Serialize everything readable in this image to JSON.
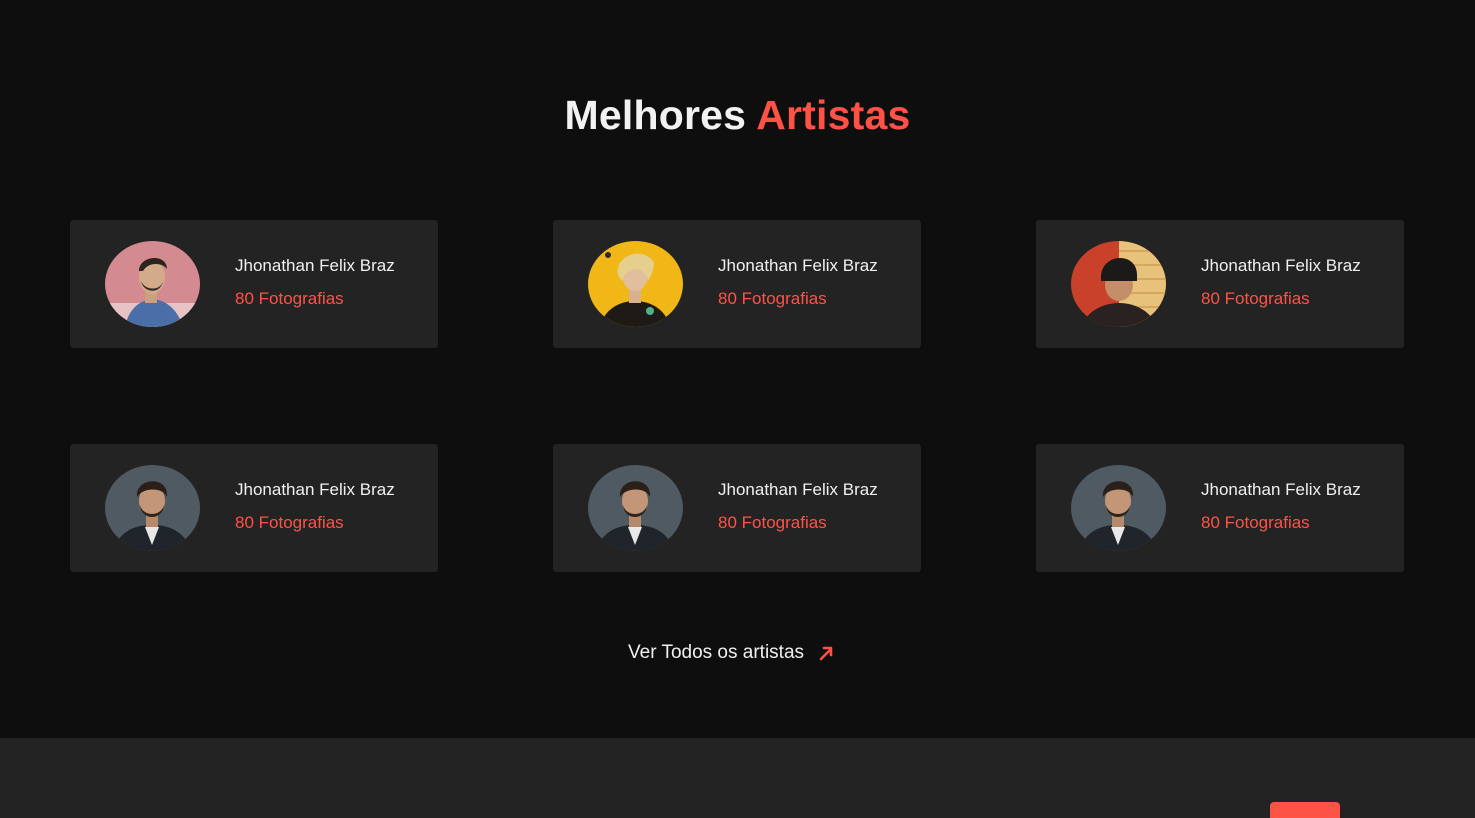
{
  "section": {
    "title_main": "Melhores",
    "title_accent": "Artistas"
  },
  "artists": [
    {
      "name": "Jhonathan Felix Braz",
      "count": "80 Fotografias",
      "photo": "man-profile-pink-background"
    },
    {
      "name": "Jhonathan Felix Braz",
      "count": "80 Fotografias",
      "photo": "blond-man-yellow-background"
    },
    {
      "name": "Jhonathan Felix Braz",
      "count": "80 Fotografias",
      "photo": "man-beanie-red-background"
    },
    {
      "name": "Jhonathan Felix Braz",
      "count": "80 Fotografias",
      "photo": "bearded-man-dark-background"
    },
    {
      "name": "Jhonathan Felix Braz",
      "count": "80 Fotografias",
      "photo": "bearded-man-dark-background"
    },
    {
      "name": "Jhonathan Felix Braz",
      "count": "80 Fotografias",
      "photo": "bearded-man-dark-background"
    }
  ],
  "view_all": {
    "label": "Ver Todos os artistas",
    "icon": "arrow-up-right-icon"
  },
  "colors": {
    "accent": "#ff5247",
    "background": "#0e0e0e",
    "card": "#232323"
  }
}
